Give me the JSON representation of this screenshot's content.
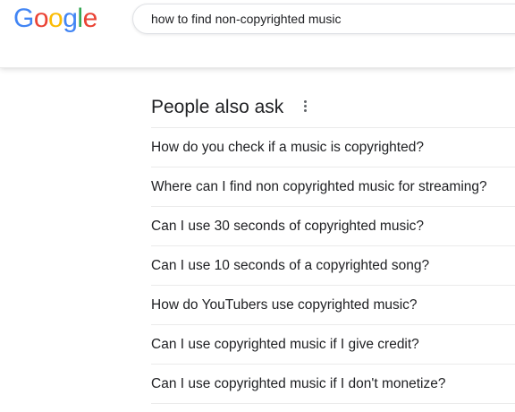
{
  "logo": {
    "letters": [
      {
        "char": "G",
        "color": "#4285F4"
      },
      {
        "char": "o",
        "color": "#EA4335"
      },
      {
        "char": "o",
        "color": "#FBBC05"
      },
      {
        "char": "g",
        "color": "#4285F4"
      },
      {
        "char": "l",
        "color": "#34A853"
      },
      {
        "char": "e",
        "color": "#EA4335"
      }
    ]
  },
  "search": {
    "value": "how to find non-copyrighted music"
  },
  "people_also_ask": {
    "title": "People also ask",
    "more_icon": "more-vert-icon",
    "questions": [
      "How do you check if a music is copyrighted?",
      "Where can I find non copyrighted music for streaming?",
      "Can I use 30 seconds of copyrighted music?",
      "Can I use 10 seconds of a copyrighted song?",
      "How do YouTubers use copyrighted music?",
      "Can I use copyrighted music if I give credit?",
      "Can I use copyrighted music if I don't monetize?"
    ]
  }
}
